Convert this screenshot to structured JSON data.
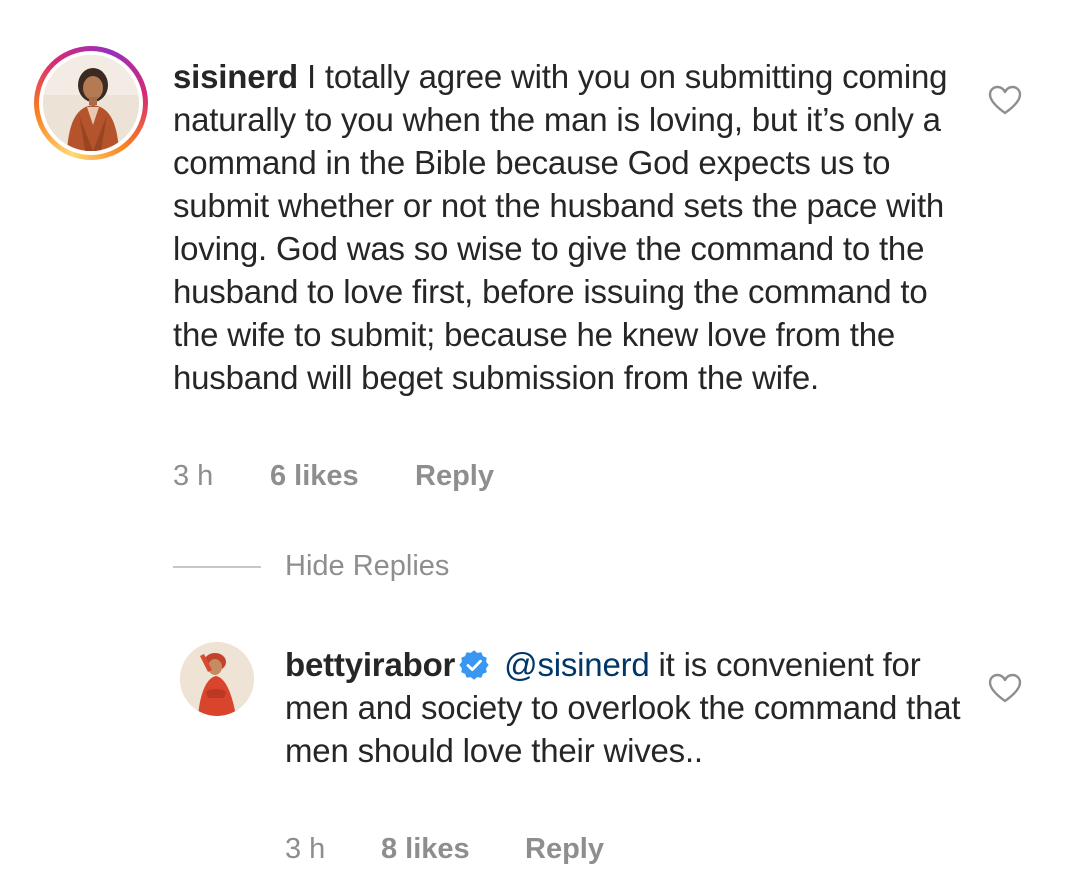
{
  "comment": {
    "username": "sisinerd",
    "text": "I totally agree with you on submitting coming naturally to you when the man is loving, but it’s only a command in the Bible because God expects us to submit whether or not the husband sets the pace with loving. God was so wise to give the command to the husband to love first, before issuing the command to the wife to submit; because he knew love from the husband will beget submission from the wife.",
    "time": "3 h",
    "likes": "6 likes",
    "reply_label": "Reply",
    "avatar_icon": "profile-photo",
    "like_icon": "heart-outline-icon",
    "story_ring_colors": [
      "#feda75",
      "#fa7e1e",
      "#d62976",
      "#962fbf"
    ]
  },
  "hide_replies_label": "Hide Replies",
  "reply": {
    "username": "bettyirabor",
    "verified": true,
    "verified_color": "#3897f0",
    "mention": "@sisinerd",
    "text": "it is convenient for men and society to overlook the command that men should love their wives..",
    "time": "3 h",
    "likes": "8 likes",
    "reply_label": "Reply",
    "avatar_icon": "profile-photo",
    "like_icon": "heart-outline-icon"
  },
  "colors": {
    "text": "#262626",
    "meta": "#8e8e8e",
    "mention": "#00376b",
    "divider": "#c7c7c7"
  }
}
